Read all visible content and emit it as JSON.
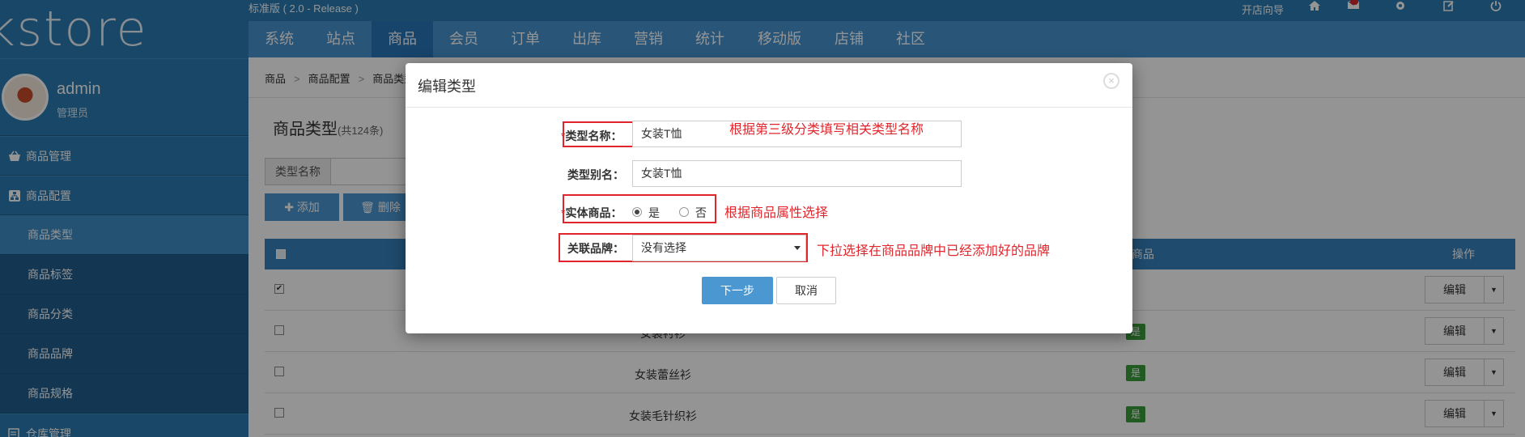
{
  "app": {
    "logo_text": "kstore",
    "version": "标准版 ( 2.0 - Release )",
    "guide_label": "开店向导"
  },
  "user": {
    "name": "admin",
    "role": "管理员"
  },
  "sidebar": {
    "groups": [
      {
        "label": "商品管理",
        "icon": "basket-icon"
      },
      {
        "label": "商品配置",
        "icon": "sitemap-icon"
      }
    ],
    "sub_items": [
      {
        "label": "商品类型",
        "active": true
      },
      {
        "label": "商品标签",
        "active": false
      },
      {
        "label": "商品分类",
        "active": false
      },
      {
        "label": "商品品牌",
        "active": false
      },
      {
        "label": "商品规格",
        "active": false
      }
    ],
    "warehouse_label": "仓库管理"
  },
  "nav": {
    "items": [
      "系统",
      "站点",
      "商品",
      "会员",
      "订单",
      "出库",
      "营销",
      "统计",
      "移动版",
      "店铺",
      "社区"
    ],
    "active_index": 2
  },
  "breadcrumb": [
    "商品",
    "商品配置",
    "商品类型"
  ],
  "page": {
    "title": "商品类型",
    "count": "(共124条)",
    "filter_label": "类型名称",
    "add_label": "添加",
    "delete_label": "删除"
  },
  "table": {
    "header_goods": "商品",
    "header_ops": "操作",
    "rows": [
      {
        "name": "",
        "yes": "",
        "checked": true
      },
      {
        "name": "女装衬衫",
        "yes": "是",
        "checked": false
      },
      {
        "name": "女装蕾丝衫",
        "yes": "是",
        "checked": false
      },
      {
        "name": "女装毛针织衫",
        "yes": "是",
        "checked": false
      }
    ],
    "edit_label": "编辑"
  },
  "modal": {
    "title": "编辑类型",
    "required_mark": "*",
    "name_label": "类型名称：",
    "name_value": "女装T恤",
    "name_note": "根据第三级分类填写相关类型名称",
    "alias_label": "类型别名：",
    "alias_value": "女装T恤",
    "physical_label": "实体商品：",
    "option_yes": "是",
    "option_no": "否",
    "physical_selected": "是",
    "physical_note": "根据商品属性选择",
    "brand_label": "关联品牌：",
    "brand_value": "没有选择",
    "brand_note": "下拉选择在商品品牌中已经添加好的品牌",
    "next_label": "下一步",
    "cancel_label": "取消"
  }
}
